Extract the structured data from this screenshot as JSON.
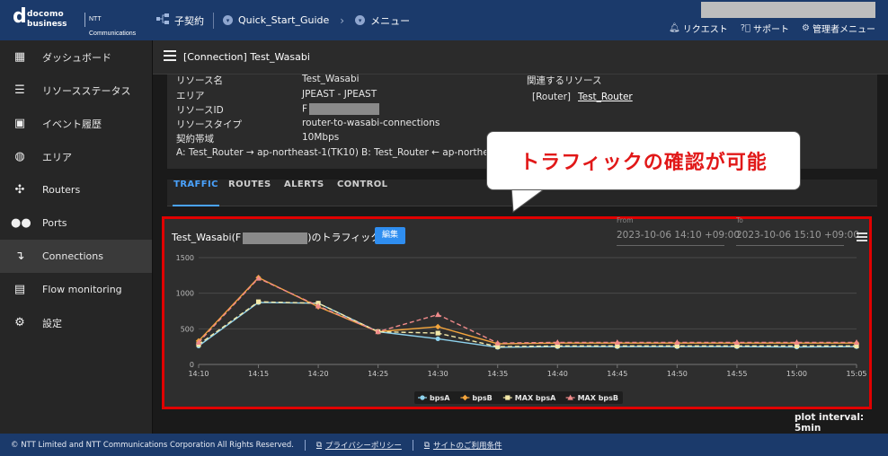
{
  "header": {
    "brand_d": "d",
    "brand_line1": "docomo",
    "brand_line2": "business",
    "ntt_text": "NTT Communications",
    "nav": [
      {
        "label": "子契約"
      },
      {
        "label": "Quick_Start_Guide"
      },
      {
        "label": "メニュー"
      }
    ],
    "links": [
      {
        "label": "リクエスト"
      },
      {
        "label": "サポート"
      },
      {
        "label": "管理者メニュー"
      }
    ]
  },
  "sidebar": {
    "items": [
      {
        "label": "ダッシュボード"
      },
      {
        "label": "リソースステータス"
      },
      {
        "label": "イベント履歴"
      },
      {
        "label": "エリア"
      },
      {
        "label": "Routers"
      },
      {
        "label": "Ports"
      },
      {
        "label": "Connections"
      },
      {
        "label": "Flow monitoring"
      },
      {
        "label": "設定"
      }
    ]
  },
  "page": {
    "title": "[Connection] Test_Wasabi"
  },
  "info": {
    "resource_name_label": "リソース名",
    "resource_name": "Test_Wasabi",
    "area_label": "エリア",
    "area": "JPEAST - JPEAST",
    "resource_id_label": "リソースID",
    "resource_id_prefix": "F",
    "resource_type_label": "リソースタイプ",
    "resource_type": "router-to-wasabi-connections",
    "bandwidth_label": "契約帯域",
    "bandwidth": "10Mbps",
    "path_a": "A: Test_Router → ap-northeast-1(TK10)",
    "path_b": "B: Test_Router ← ap-northea",
    "related_label": "関連するリソース",
    "related_type": "[Router]",
    "related_link": "Test_Router"
  },
  "callout": {
    "text": "トラフィックの確認が可能"
  },
  "tabs": [
    {
      "label": "TRAFFIC"
    },
    {
      "label": "ROUTES"
    },
    {
      "label": "ALERTS"
    },
    {
      "label": "CONTROL"
    }
  ],
  "chart": {
    "title_prefix": "Test_Wasabi(F",
    "title_suffix": ")のトラフィック",
    "edit_label": "編集",
    "from_label": "From",
    "from_value": "2023-10-06 14:10 +09:00",
    "to_label": "To",
    "to_value": "2023-10-06 15:10 +09:00",
    "plot_interval": "plot interval: 5min"
  },
  "chart_data": {
    "type": "line",
    "x": [
      "14:10",
      "14:15",
      "14:20",
      "14:25",
      "14:30",
      "14:35",
      "14:40",
      "14:45",
      "14:50",
      "14:55",
      "15:00",
      "15:05"
    ],
    "ylim": [
      0,
      1500
    ],
    "yticks": [
      0,
      500,
      1000,
      1500
    ],
    "grid": true,
    "legend_position": "bottom",
    "series": [
      {
        "name": "bpsA",
        "color": "#8fd3ee",
        "dash": false,
        "marker": "circle",
        "values": [
          260,
          870,
          860,
          460,
          360,
          240,
          250,
          250,
          250,
          250,
          245,
          250
        ]
      },
      {
        "name": "bpsB",
        "color": "#f4a53c",
        "dash": false,
        "marker": "diamond",
        "values": [
          330,
          1220,
          810,
          460,
          530,
          290,
          300,
          300,
          300,
          300,
          300,
          300
        ]
      },
      {
        "name": "MAX bpsA",
        "color": "#f4e9a8",
        "dash": true,
        "marker": "square",
        "values": [
          280,
          880,
          860,
          460,
          440,
          250,
          260,
          260,
          260,
          260,
          260,
          260
        ]
      },
      {
        "name": "MAX bpsB",
        "color": "#f08a8a",
        "dash": true,
        "marker": "triangle",
        "values": [
          310,
          1210,
          820,
          460,
          700,
          300,
          310,
          310,
          310,
          310,
          310,
          310
        ]
      }
    ]
  },
  "footer": {
    "copyright": "© NTT Limited and NTT Communications Corporation All Rights Reserved.",
    "privacy": "プライバシーポリシー",
    "terms": "サイトのご利用条件"
  }
}
